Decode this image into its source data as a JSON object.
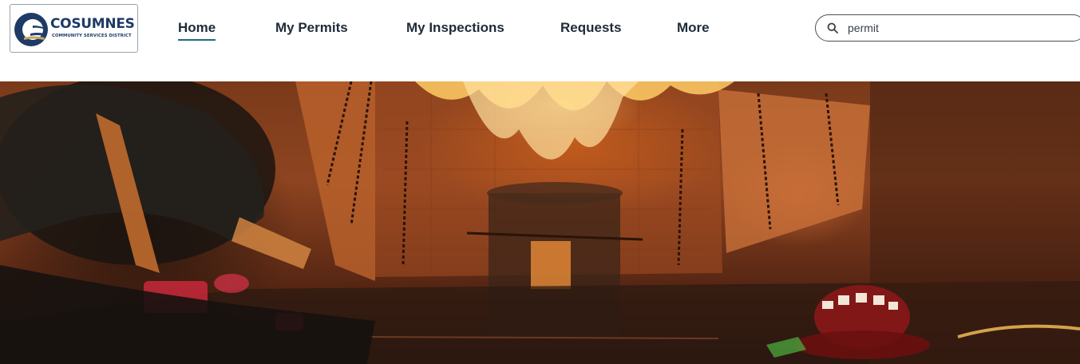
{
  "logo": {
    "name": "COSUMNES",
    "subtitle": "COMMUNITY SERVICES DISTRICT",
    "icon": "cosumnes-c-logo-icon"
  },
  "nav": {
    "items": [
      {
        "label": "Home",
        "active": true
      },
      {
        "label": "My Permits",
        "active": false
      },
      {
        "label": "My Inspections",
        "active": false
      },
      {
        "label": "Requests",
        "active": false
      },
      {
        "label": "More",
        "active": false
      }
    ]
  },
  "search": {
    "value": "permit",
    "icon": "search-icon"
  },
  "hero": {
    "image": "firefighter-training-fire-scene-image"
  },
  "colors": {
    "brand_navy": "#1e3b66",
    "nav_text": "#1f2b38",
    "active_underline": "#1f6b84"
  }
}
